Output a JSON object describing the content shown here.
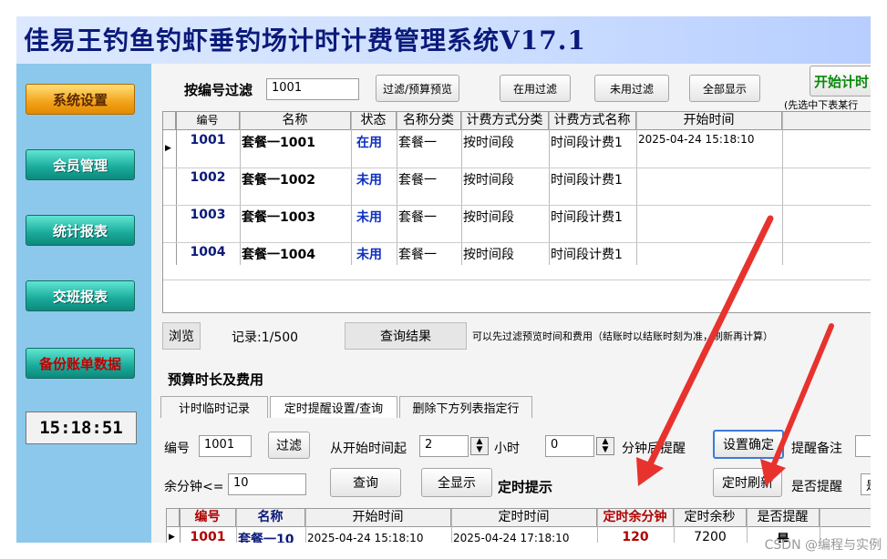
{
  "app": {
    "title": "佳易王钓鱼钓虾垂钓场计时计费管理系统V17.1",
    "clock": "15:18:51"
  },
  "sidebar": {
    "items": [
      {
        "label": "系统设置"
      },
      {
        "label": "会员管理"
      },
      {
        "label": "统计报表"
      },
      {
        "label": "交班报表"
      },
      {
        "label": "备份账单数据"
      }
    ]
  },
  "filter": {
    "label": "按编号过滤",
    "value": "1001",
    "preview_btn": "过滤/预算预览",
    "inuse_btn": "在用过滤",
    "unused_btn": "未用过滤",
    "showall_btn": "全部显示",
    "start_btn": "开始计时",
    "start_hint": "(先选中下表某行"
  },
  "top_grid": {
    "headers": [
      "编号",
      "名称",
      "状态",
      "名称分类",
      "计费方式分类",
      "计费方式名称",
      "开始时间"
    ],
    "rows": [
      [
        "1001",
        "套餐一1001",
        "在用",
        "套餐一",
        "按时间段",
        "时间段计费1",
        "2025-04-24 15:18:10"
      ],
      [
        "1002",
        "套餐一1002",
        "未用",
        "套餐一",
        "按时间段",
        "时间段计费1",
        ""
      ],
      [
        "1003",
        "套餐一1003",
        "未用",
        "套餐一",
        "按时间段",
        "时间段计费1",
        ""
      ],
      [
        "1004",
        "套餐一1004",
        "未用",
        "套餐一",
        "按时间段",
        "时间段计费1",
        ""
      ]
    ]
  },
  "status_bar": {
    "browse": "浏览",
    "records": "记录:1/500",
    "query_result": "查询结果",
    "hint": "可以先过滤预览时间和费用（结账时以结账时刻为准，刷新再计算）"
  },
  "budget": {
    "title": "预算时长及费用"
  },
  "tabs": [
    "计时临时记录",
    "定时提醒设置/查询",
    "删除下方列表指定行"
  ],
  "reminder": {
    "id_label": "编号",
    "id_value": "1001",
    "filter_btn": "过滤",
    "from_label": "从开始时间起",
    "hours_value": "2",
    "hours_unit": "小时",
    "minutes_value": "0",
    "minutes_unit": "分钟后提醒",
    "confirm_btn": "设置确定",
    "note_label": "提醒备注",
    "remain_label": "余分钟<=",
    "remain_value": "10",
    "query_btn": "查询",
    "showall_btn": "全显示",
    "timer_hint": "定时提示",
    "refresh_btn": "定时刷新",
    "remind_label": "是否提醒",
    "remind_value": "是"
  },
  "bottom_grid": {
    "headers": [
      "编号",
      "名称",
      "开始时间",
      "定时时间",
      "定时余分钟",
      "定时余秒",
      "是否提醒"
    ],
    "rows": [
      [
        "1001",
        "套餐一10",
        "2025-04-24 15:18:10",
        "2025-04-24 17:18:10",
        "120",
        "7200",
        "是"
      ]
    ]
  },
  "watermark": "CSDN @编程与实例",
  "colors": {
    "accent_red": "#e8322e",
    "title_blue": "#0b1a7a",
    "sidebar_bg": "#8cc8ec"
  }
}
